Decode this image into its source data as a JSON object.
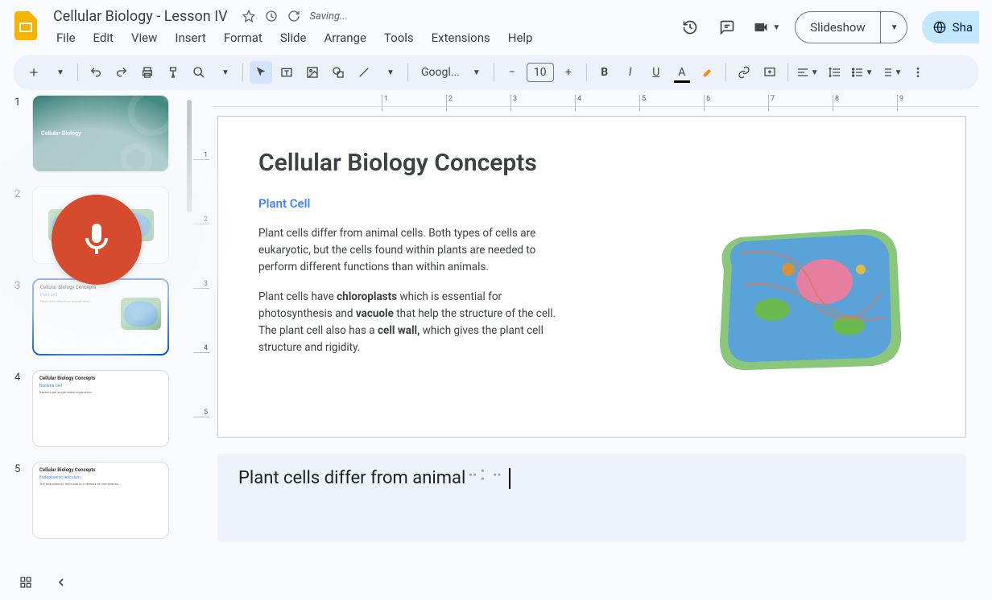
{
  "header": {
    "title": "Cellular Biology - Lesson IV",
    "saving": "Saving...",
    "menus": [
      "File",
      "Edit",
      "View",
      "Insert",
      "Format",
      "Slide",
      "Arrange",
      "Tools",
      "Extensions",
      "Help"
    ],
    "slideshow_label": "Slideshow",
    "share_label": "Sha"
  },
  "toolbar": {
    "font_label": "Googl...",
    "font_size": "10"
  },
  "filmstrip": {
    "slides": [
      {
        "num": "1",
        "title": "Cellular Biology",
        "sub": ""
      },
      {
        "num": "2",
        "title": "",
        "sub": ""
      },
      {
        "num": "3",
        "title": "Cellular Biology Concepts",
        "sub": "Plant Cell"
      },
      {
        "num": "4",
        "title": "Cellular Biology Concepts",
        "sub": "Bacteria Cell"
      },
      {
        "num": "5",
        "title": "Cellular Biology Concepts",
        "sub": "Endoplasmic reticulum"
      }
    ]
  },
  "ruler": {
    "h": [
      "1",
      "2",
      "3",
      "4",
      "5",
      "6",
      "7",
      "8",
      "9"
    ],
    "v": [
      "1",
      "2",
      "3",
      "4",
      "5"
    ]
  },
  "slide": {
    "title": "Cellular Biology Concepts",
    "subtitle": "Plant Cell",
    "para1_a": "Plant cells differ from animal cells. Both types of cells are eukaryotic, but the cells found within plants are needed to perform different functions than within animals.",
    "para2_a": "Plant cells have ",
    "para2_b": "chloroplasts",
    "para2_c": " which is essential for photosynthesis and ",
    "para2_d": "vacuole",
    "para2_e": " that help the structure of the cell. The plant cell also has a ",
    "para2_f": "cell wall,",
    "para2_g": " which gives the plant cell structure and rigidity."
  },
  "notes": {
    "text": "Plant cells differ from animal"
  }
}
